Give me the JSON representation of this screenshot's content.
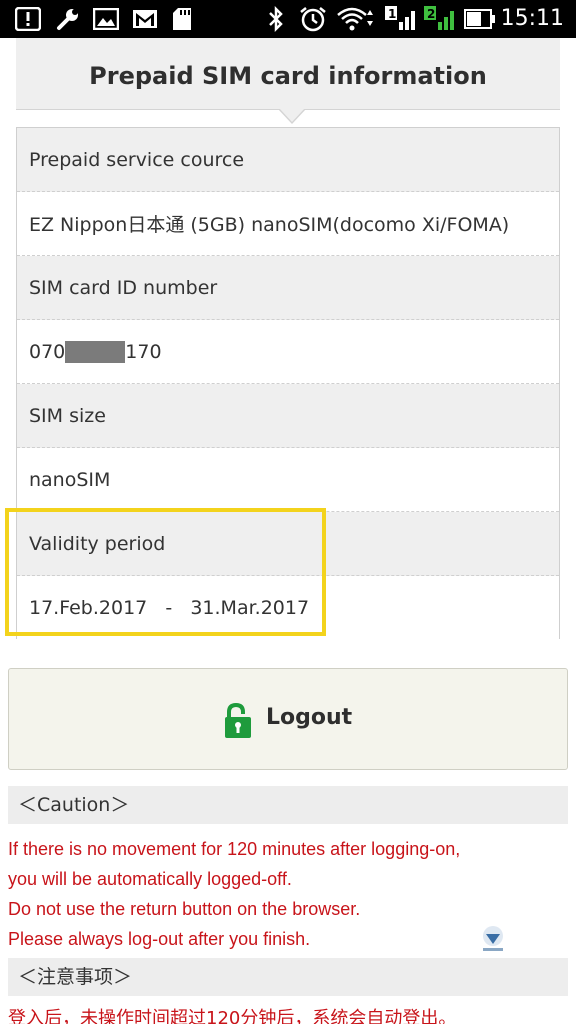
{
  "status_bar": {
    "time": "15:11",
    "icons": [
      "notification-icon",
      "wrench-icon",
      "image-icon",
      "gmail-icon",
      "sd-card-icon",
      "bluetooth-icon",
      "alarm-icon",
      "wifi-icon",
      "signal-1-icon",
      "signal-2-icon",
      "battery-icon"
    ],
    "sim1_label": "1",
    "sim2_label": "2"
  },
  "header": {
    "title": "Prepaid SIM card information"
  },
  "info": {
    "rows": [
      {
        "label": "Prepaid service cource",
        "value": "EZ Nippon日本通 (5GB) nanoSIM(docomo Xi/FOMA)"
      },
      {
        "label": "SIM card ID number",
        "value_prefix": "070",
        "value_suffix": "170"
      },
      {
        "label": "SIM size",
        "value": "nanoSIM"
      },
      {
        "label": "Validity period",
        "value": "17.Feb.2017   -   31.Mar.2017"
      }
    ]
  },
  "logout": {
    "label": "Logout",
    "icon": "unlocked-padlock-icon",
    "icon_color": "#1e9b3c"
  },
  "caution": {
    "heading": "＜Caution＞",
    "lines": [
      "If there is no movement for 120 minutes after logging-on,",
      "you will be automatically logged-off.",
      "Do not use the return button on the browser.",
      "Please always log-out after you finish."
    ]
  },
  "caution_cn": {
    "heading": "＜注意事项＞",
    "line": "登入后，未操作时间超过120分钟后，系统会自动登出。"
  },
  "colors": {
    "alert_text": "#c8141a",
    "highlight": "#f3d31c",
    "header_bg": "#efefef"
  }
}
